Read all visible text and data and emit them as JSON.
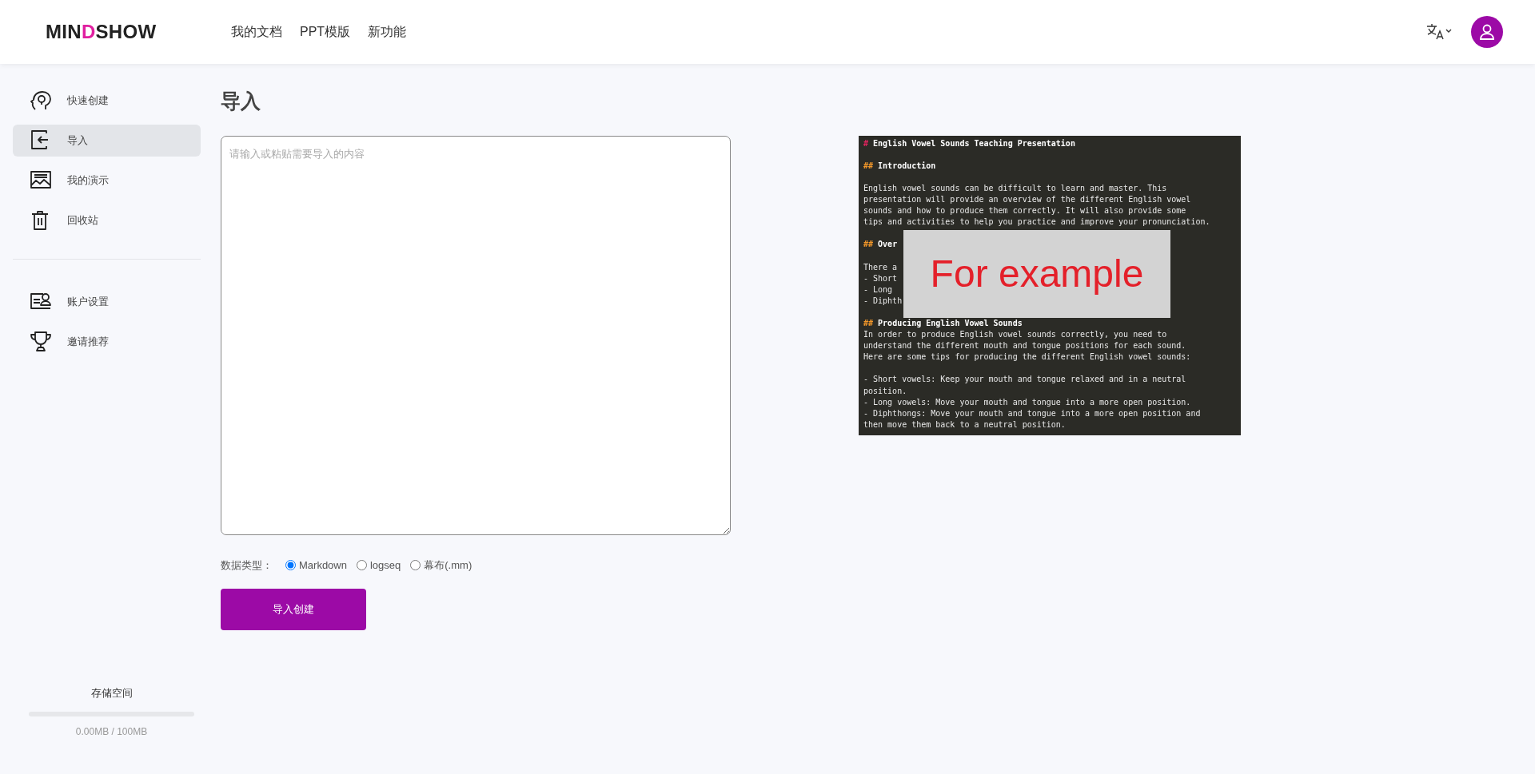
{
  "header": {
    "logo": {
      "before": "MIN",
      "accent": "D",
      "after": "SHOW"
    },
    "nav": [
      {
        "label": "我的文档"
      },
      {
        "label": "PPT模版"
      },
      {
        "label": "新功能"
      }
    ]
  },
  "sidebar": {
    "groups": [
      {
        "items": [
          {
            "label": "快速创建",
            "selected": false
          },
          {
            "label": "导入",
            "selected": true
          },
          {
            "label": "我的演示",
            "selected": false
          },
          {
            "label": "回收站",
            "selected": false
          }
        ]
      },
      {
        "items": [
          {
            "label": "账户设置",
            "selected": false
          },
          {
            "label": "邀请推荐",
            "selected": false
          }
        ]
      }
    ],
    "storage": {
      "title": "存储空间",
      "level": 0,
      "reading": "0.00MB / 100MB"
    }
  },
  "main": {
    "title": "导入",
    "input": {
      "placeholder": "请输入或粘贴需要导入的内容"
    },
    "data_type": {
      "label": "数据类型：",
      "options": [
        {
          "label": "Markdown",
          "selected": true
        },
        {
          "label": "logseq",
          "selected": false
        },
        {
          "label": "幕布(.mm)",
          "selected": false
        }
      ]
    },
    "submit": "导入创建",
    "example": {
      "overlay": "For example",
      "blocks": [
        {
          "lines": [
            {
              "kind": "heading",
              "marker": "#",
              "color": "#e0245e",
              "text": "English Vowel Sounds Teaching Presentation"
            }
          ]
        },
        {
          "lines": [
            {
              "kind": "heading",
              "marker": "##",
              "color": "#f0962a",
              "text": "Introduction"
            }
          ]
        },
        {
          "lines": [
            {
              "kind": "text",
              "text": "English vowel sounds can be difficult to learn and master. This"
            },
            {
              "kind": "text",
              "text": "presentation will provide an overview of the different English vowel"
            },
            {
              "kind": "text",
              "text": "sounds and how to produce them correctly. It will also provide some"
            },
            {
              "kind": "text",
              "text": "tips and activities to help you practice and improve your pronunciation."
            }
          ]
        },
        {
          "lines": [
            {
              "kind": "heading",
              "marker": "##",
              "color": "#f0962a",
              "text": "Over"
            }
          ]
        },
        {
          "lines": [
            {
              "kind": "text",
              "text": "There a"
            },
            {
              "kind": "text",
              "text": "- Short"
            },
            {
              "kind": "text",
              "text": "- Long"
            },
            {
              "kind": "text",
              "text": "- Diphth"
            }
          ]
        },
        {
          "lines": [
            {
              "kind": "heading",
              "marker": "##",
              "color": "#f0962a",
              "text": "Producing English Vowel Sounds"
            },
            {
              "kind": "text",
              "text": "In order to produce English vowel sounds correctly, you need to"
            },
            {
              "kind": "text",
              "text": "understand the different mouth and tongue positions for each sound."
            },
            {
              "kind": "text",
              "text": "Here are some tips for producing the different English vowel sounds:"
            }
          ]
        },
        {
          "lines": [
            {
              "kind": "text",
              "text": "- Short vowels: Keep your mouth and tongue relaxed and in a neutral"
            },
            {
              "kind": "text",
              "text": "position."
            },
            {
              "kind": "text",
              "text": "- Long vowels: Move your mouth and tongue into a more open position."
            },
            {
              "kind": "text",
              "text": "- Diphthongs: Move your mouth and tongue into a more open position and"
            },
            {
              "kind": "text",
              "text": "then move them back to a neutral position."
            }
          ]
        }
      ]
    }
  }
}
